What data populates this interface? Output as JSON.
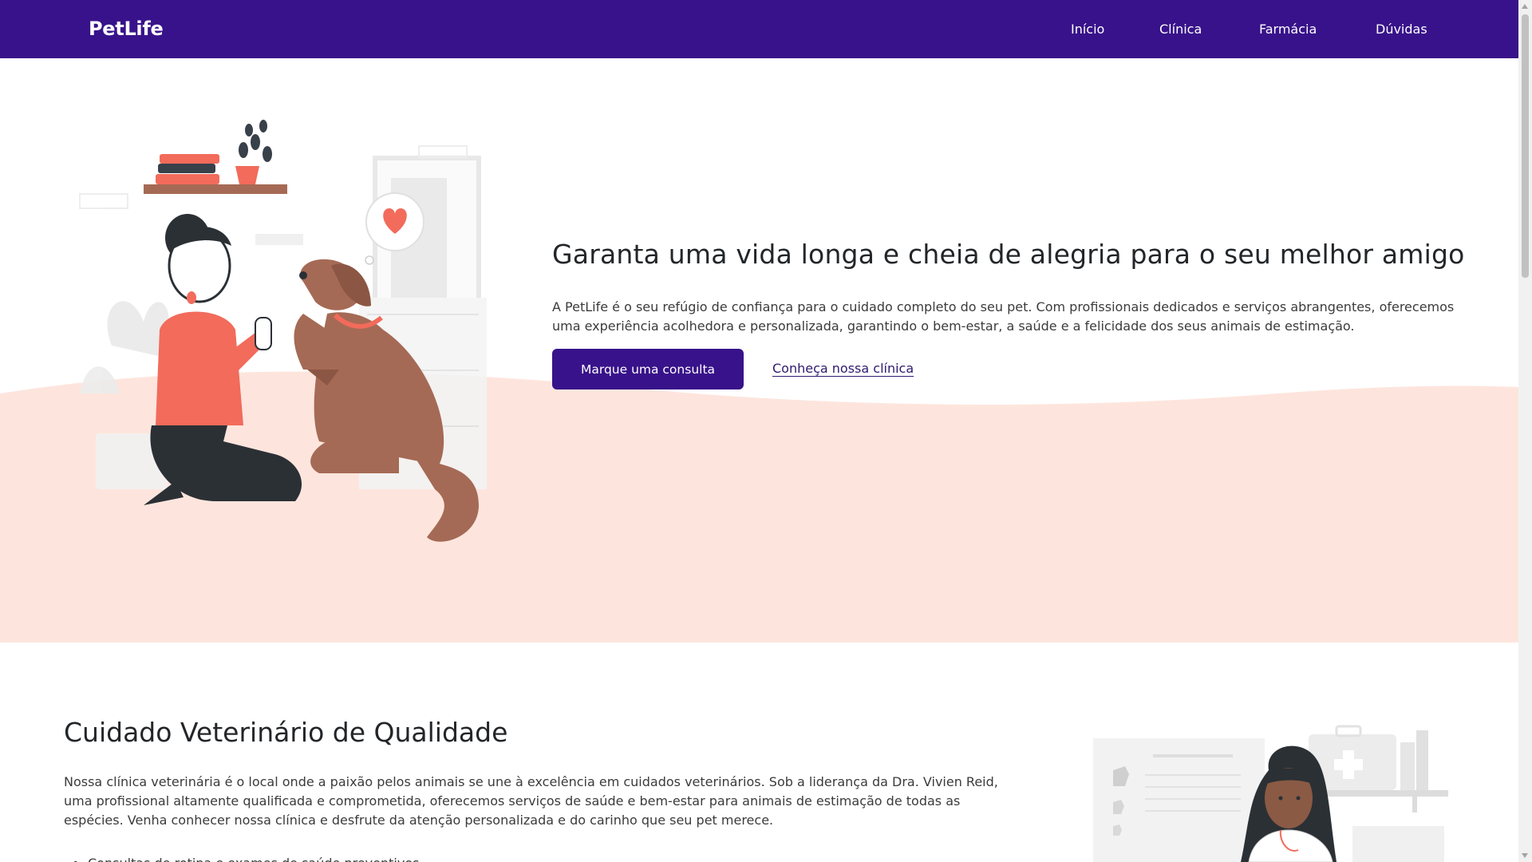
{
  "navbar": {
    "brand": "PetLife",
    "links": [
      "Início",
      "Clínica",
      "Farmácia",
      "Dúvidas"
    ]
  },
  "hero": {
    "title": "Garanta uma vida longa e cheia de alegria para o seu melhor amigo",
    "text": "A PetLife é o seu refúgio de confiança para o cuidado completo do seu pet. Com profissionais dedicados e serviços abrangentes, oferecemos uma experiência acolhedora e personalizada, garantindo o bem-estar, a saúde e a felicidade dos seus animais de estimação.",
    "primary_button": "Marque uma consulta",
    "secondary_link": "Conheça nossa clínica"
  },
  "section_quality": {
    "title": "Cuidado Veterinário de Qualidade",
    "text": "Nossa clínica veterinária é o local onde a paixão pelos animais se une à excelência em cuidados veterinários. Sob a liderança da Dra. Vivien Reid, uma profissional altamente qualificada e comprometida, oferecemos serviços de saúde e bem-estar para animais de estimação de todas as espécies. Venha conhecer nossa clínica e desfrute da atenção personalizada e do carinho que seu pet merece.",
    "list_items": [
      "Consultas de rotina e exames de saúde preventivos"
    ]
  },
  "colors": {
    "primary": "#38128a",
    "hero_wave": "#fde5dd",
    "accent": "#f26b5b",
    "dog": "#a56a55"
  },
  "icons": [
    "heart-icon"
  ]
}
